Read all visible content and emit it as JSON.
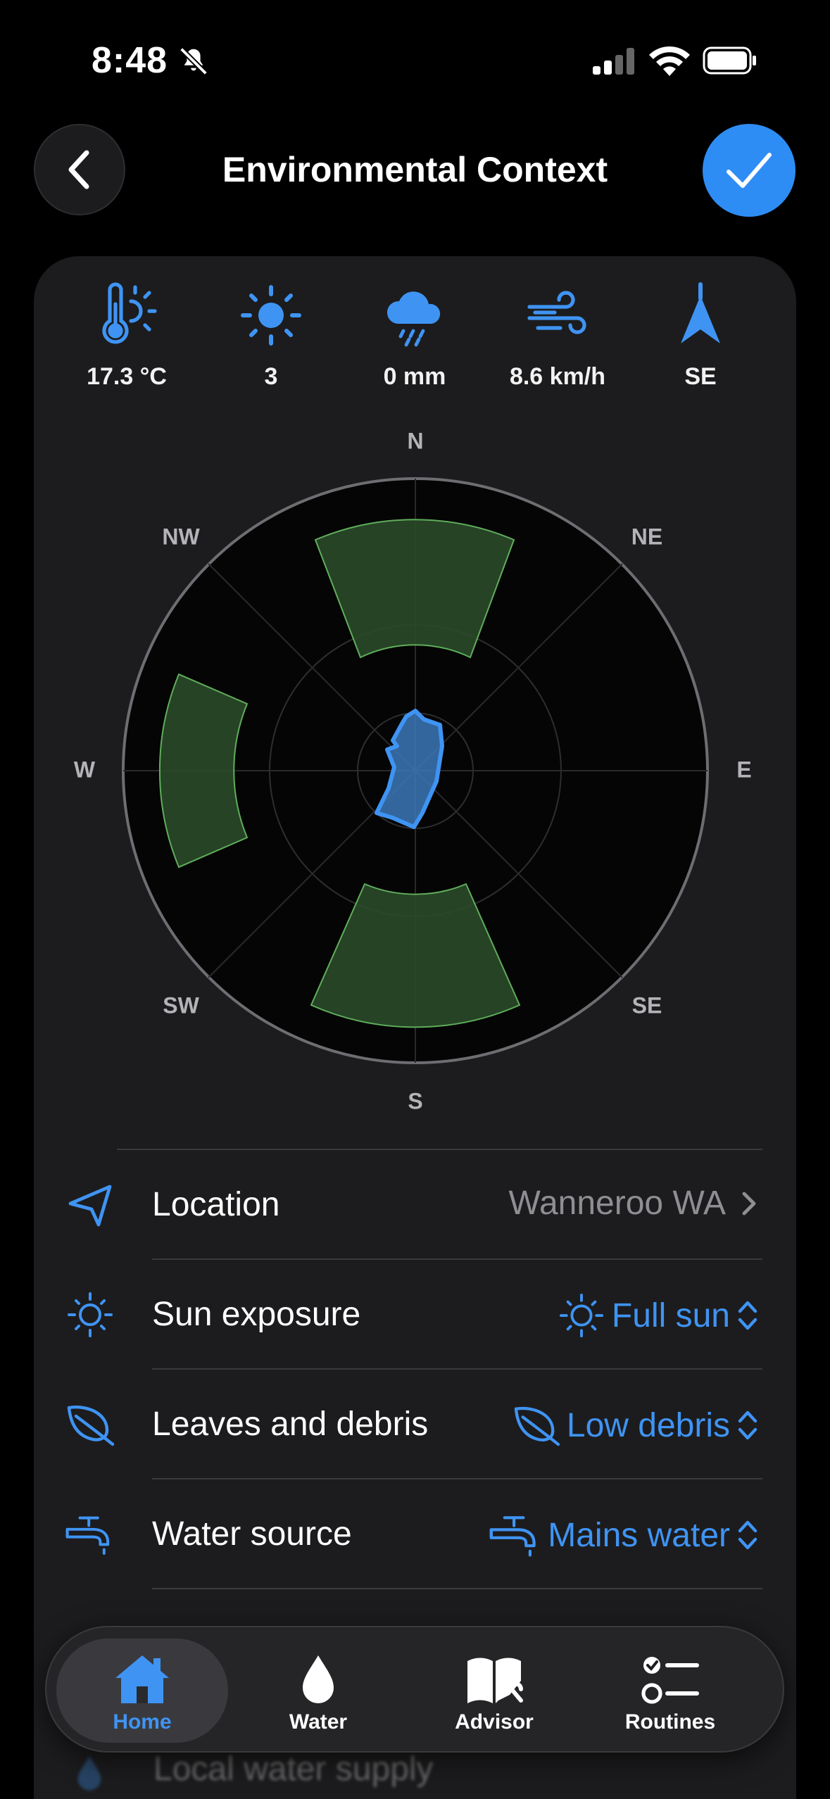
{
  "status_bar": {
    "time": "8:48"
  },
  "header": {
    "title": "Environmental Context"
  },
  "weather": [
    {
      "icon": "thermometer-sun-icon",
      "value": "17.3 °C"
    },
    {
      "icon": "sun-icon",
      "value": "3"
    },
    {
      "icon": "rain-cloud-icon",
      "value": "0 mm"
    },
    {
      "icon": "wind-icon",
      "value": "8.6 km/h"
    },
    {
      "icon": "wind-direction-arrow-icon",
      "value": "SE"
    }
  ],
  "compass": {
    "labels": {
      "n": "N",
      "ne": "NE",
      "e": "E",
      "se": "SE",
      "s": "S",
      "sw": "SW",
      "w": "W",
      "nw": "NW"
    },
    "sun_sectors": [
      "N",
      "W",
      "S"
    ],
    "wind_direction": "SE"
  },
  "settings": [
    {
      "icon": "location-arrow-icon",
      "label": "Location",
      "value": "Wanneroo WA",
      "value_icon": "chevron-right-icon"
    },
    {
      "icon": "sun-icon",
      "label": "Sun exposure",
      "value": "Full sun",
      "value_icon": "sun-icon"
    },
    {
      "icon": "leaf-icon",
      "label": "Leaves and debris",
      "value": "Low debris",
      "value_icon": "leaf-icon"
    },
    {
      "icon": "tap-icon",
      "label": "Water source",
      "value": "Mains water",
      "value_icon": "tap-icon"
    },
    {
      "icon": "water-drop-icon",
      "label": "Local water supply",
      "value": ""
    }
  ],
  "tabs": [
    {
      "icon": "house-icon",
      "label": "Home",
      "active": true
    },
    {
      "icon": "water-drop-icon",
      "label": "Water",
      "active": false
    },
    {
      "icon": "book-tools-icon",
      "label": "Advisor",
      "active": false
    },
    {
      "icon": "checklist-icon",
      "label": "Routines",
      "active": false
    }
  ],
  "colors": {
    "accent": "#3f94f3",
    "sector_fill": "#2a4a2a",
    "sector_stroke": "#5fae5a",
    "card": "#1c1c1e"
  }
}
